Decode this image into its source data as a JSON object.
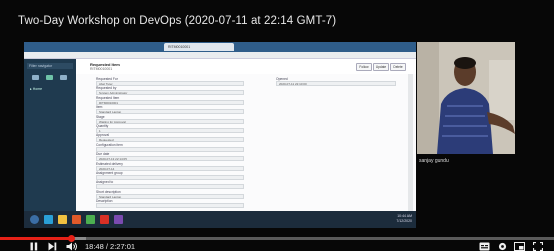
{
  "video": {
    "title": "Two-Day Workshop on DevOps (2020-07-11 at 22:14 GMT-7)",
    "time_display": "18:48 / 2:27:01",
    "progress_fraction": 0.128,
    "buffered_fraction": 0.155,
    "accent_color": "#e62117"
  },
  "webcam": {
    "presenter_name": "sanjay gundu"
  },
  "shared_screen": {
    "nav_filter_placeholder": "Filter navigator",
    "record_title": "Requested Item",
    "record_subtitle": "RITM0010001",
    "header_buttons": [
      "Follow",
      "Update",
      "Delete"
    ],
    "left_fields": [
      {
        "label": "Requested For",
        "value": "Abel Tuter"
      },
      {
        "label": "Requested by",
        "value": "System Administrator"
      },
      {
        "label": "Requested Item",
        "value": "RITM0010001"
      },
      {
        "label": "Item",
        "value": "Standard Laptop"
      },
      {
        "label": "Stage",
        "value": "Waiting for Approval"
      },
      {
        "label": "Quantity",
        "value": "1"
      },
      {
        "label": "Approval",
        "value": "Requested"
      },
      {
        "label": "Configuration item",
        "value": ""
      },
      {
        "label": "Due date",
        "value": "2020-07-13 22:14:05"
      },
      {
        "label": "Estimated delivery",
        "value": "2020-07-14"
      },
      {
        "label": "Assignment group",
        "value": ""
      },
      {
        "label": "Assigned to",
        "value": ""
      },
      {
        "label": "Short description",
        "value": "Standard Laptop"
      },
      {
        "label": "Description",
        "value": ""
      }
    ],
    "right_fields": [
      {
        "label": "Opened",
        "value": "2020-07-11 22:10:00"
      }
    ],
    "taskbar_time": [
      "10:44 AM",
      "7/12/2020"
    ]
  },
  "icons": {
    "play": "play-icon",
    "next": "skip-next-icon",
    "volume": "volume-icon",
    "subtitles": "subtitles-icon",
    "settings": "gear-icon",
    "miniplayer": "miniplayer-icon",
    "fullscreen": "fullscreen-icon"
  }
}
